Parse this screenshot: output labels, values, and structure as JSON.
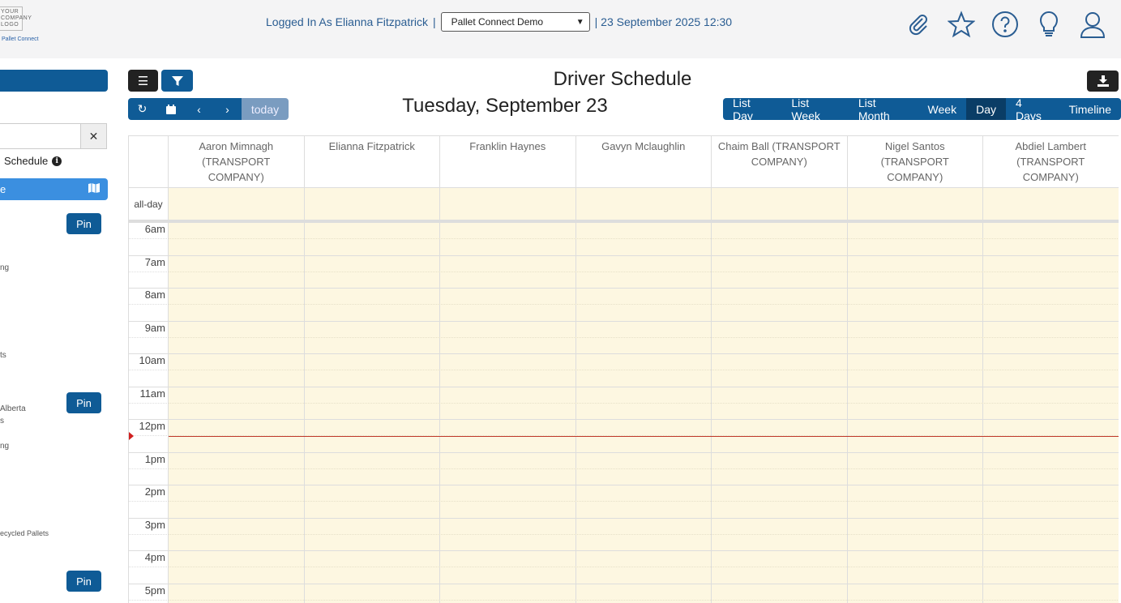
{
  "header": {
    "logo_text": "YOUR COMPANY LOGO",
    "logo_sub": "Pallet Connect",
    "logged_in": "Logged In As Elianna Fitzpatrick",
    "sep": "|",
    "company": "Pallet Connect Demo",
    "datetime": "| 23 September 2025 12:30",
    "icons": [
      "paperclip-icon",
      "star-icon",
      "help-icon",
      "lightbulb-icon",
      "user-icon"
    ]
  },
  "sidebar": {
    "schedule_label": "Schedule",
    "active_item": "e",
    "clear": "✕",
    "pin_label": "Pin",
    "fragments": [
      "ng",
      "ts",
      "Alberta",
      "s",
      "ng",
      "ecycled Pallets"
    ]
  },
  "toolbar": {
    "title": "Driver Schedule",
    "date_title": "Tuesday, September 23",
    "today": "today",
    "views": [
      "List Day",
      "List Week",
      "List Month",
      "Week",
      "Day",
      "4 Days",
      "Timeline"
    ],
    "active_view": "Day"
  },
  "calendar": {
    "allday": "all-day",
    "resources": [
      "Aaron Mimnagh (TRANSPORT COMPANY)",
      "Elianna Fitzpatrick",
      "Franklin Haynes",
      "Gavyn Mclaughlin",
      "Chaim Ball (TRANSPORT COMPANY)",
      "Nigel Santos (TRANSPORT COMPANY)",
      "Abdiel Lambert (TRANSPORT COMPANY)"
    ],
    "hours": [
      "6am",
      "7am",
      "8am",
      "9am",
      "10am",
      "11am",
      "12pm",
      "1pm",
      "2pm",
      "3pm",
      "4pm",
      "5pm"
    ],
    "now_time": "12:30"
  },
  "colors": {
    "primary": "#0f5b96",
    "active_view": "#0a3d66",
    "sidebar_active": "#3b8fe0",
    "slot_bg": "#fdf7e1",
    "now_indicator": "#c0392b"
  }
}
